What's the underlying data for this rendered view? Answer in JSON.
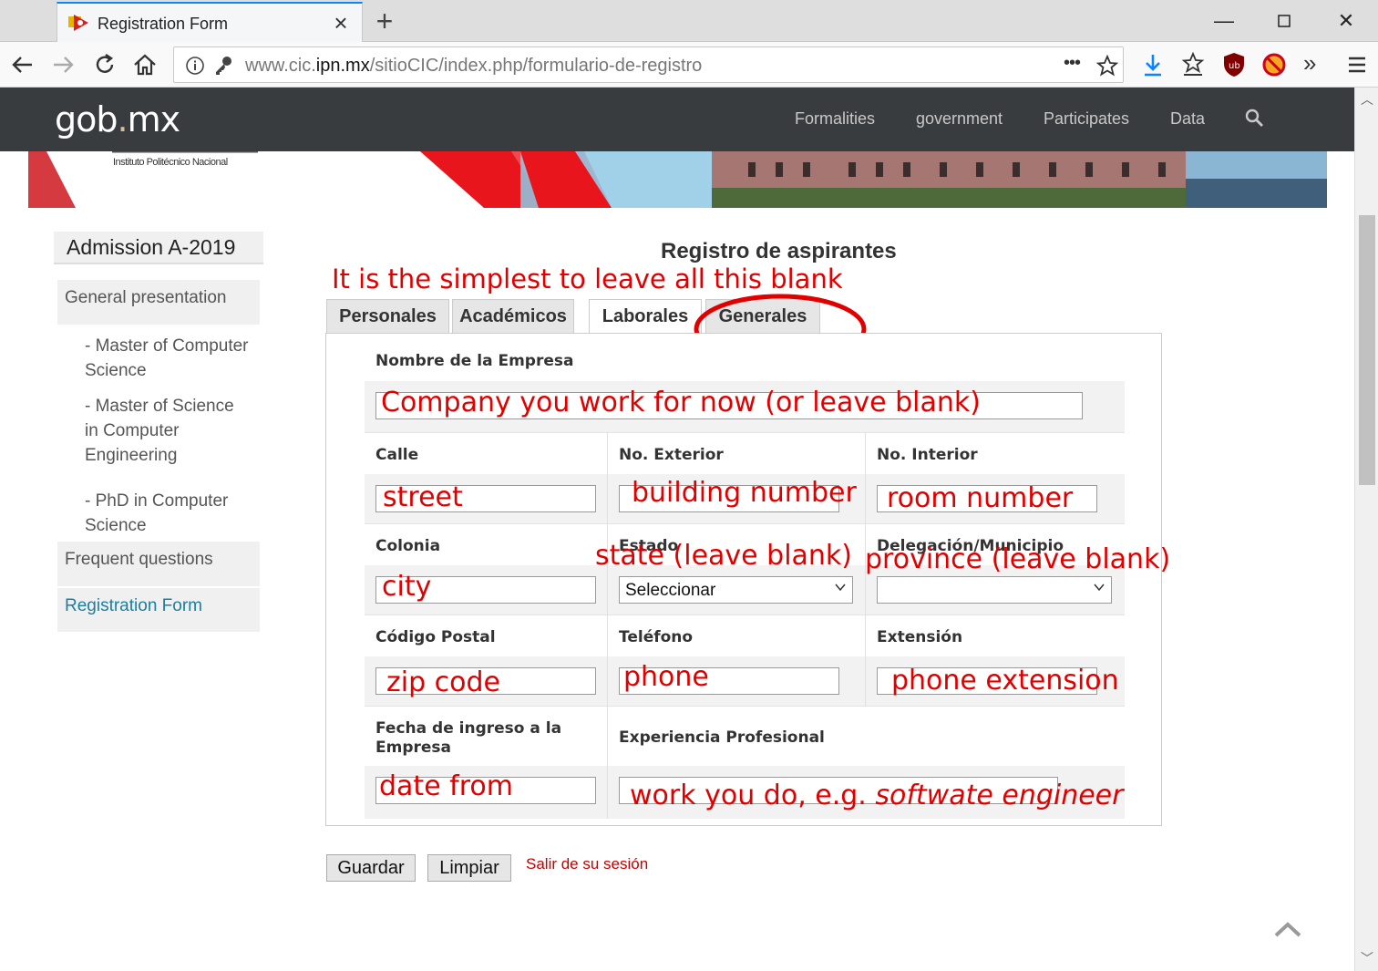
{
  "browser": {
    "tab_title": "Registration Form",
    "url_domain_prefix": "www.cic.",
    "url_domain_main": "ipn.mx",
    "url_path": "/sitioCIC/index.php/formulario-de-registro",
    "overflow_menu": "•••"
  },
  "gob": {
    "logo_left": "gob",
    "logo_dot": ".",
    "logo_right": "mx",
    "nav": [
      "Formalities",
      "government",
      "Participates",
      "Data"
    ]
  },
  "banner": {
    "institute": "Instituto Politécnico Nacional"
  },
  "sidebar": {
    "heading": "Admission A-2019",
    "items": [
      {
        "label": "General presentation"
      },
      {
        "label": "- Master of Computer Science"
      },
      {
        "label": "- Master of Science in Computer Engineering"
      },
      {
        "label": "- PhD in Computer Science"
      },
      {
        "label": "Frequent questions"
      },
      {
        "label": "Registration Form"
      }
    ],
    "active_color": "#1a7fa0"
  },
  "form": {
    "title": "Registro de aspirantes",
    "tabs": [
      "Personales",
      "Académicos",
      "Laborales",
      "Generales"
    ],
    "labels": {
      "empresa": "Nombre de la Empresa",
      "calle": "Calle",
      "no_exterior": "No. Exterior",
      "no_interior": "No. Interior",
      "colonia": "Colonia",
      "estado": "Estado",
      "delegacion": "Delegación/Municipio",
      "codigo_postal": "Código Postal",
      "telefono": "Teléfono",
      "extension": "Extensión",
      "fecha_ingreso": "Fecha de ingreso a la Empresa",
      "experiencia": "Experiencia Profesional"
    },
    "estado_selected": "Seleccionar",
    "delegacion_selected": "",
    "buttons": {
      "guardar": "Guardar",
      "limpiar": "Limpiar",
      "logout": "Salir de su sesión"
    }
  },
  "annotations": {
    "header": "It is the simplest to leave all this blank",
    "company": "Company you work for now (or leave blank)",
    "street": "street",
    "building": "building number",
    "room": "room number",
    "state": "state (leave blank)",
    "province": "province (leave blank)",
    "city": "city",
    "zip": "zip code",
    "phone": "phone",
    "phone_ext": "phone extension",
    "date_from": "date from",
    "work_prefix": "work you do, e.g. ",
    "work_example": "softwate engineer",
    "color": "#e00000"
  }
}
